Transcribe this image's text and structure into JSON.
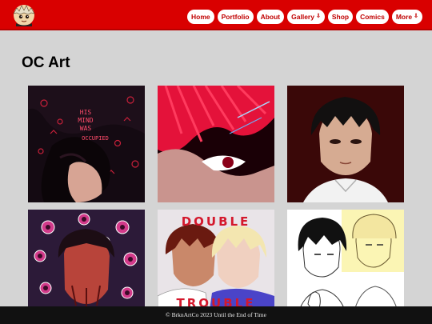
{
  "header": {
    "logo_icon": "chibi-character-logo-icon",
    "nav": [
      {
        "label": "Home",
        "dropdown": false
      },
      {
        "label": "Portfolio",
        "dropdown": false
      },
      {
        "label": "About",
        "dropdown": false
      },
      {
        "label": "Gallery",
        "dropdown": true
      },
      {
        "label": "Shop",
        "dropdown": false
      },
      {
        "label": "Comics",
        "dropdown": false
      },
      {
        "label": "More",
        "dropdown": true
      }
    ],
    "dropdown_glyph": "⇩"
  },
  "main": {
    "title": "OC Art",
    "artworks": [
      {
        "name": "artwork-his-mind-was-occupied",
        "caption_lines": [
          "HIS",
          "MIND",
          "WAS",
          "OCCUPIED"
        ]
      },
      {
        "name": "artwork-red-hair-closeup"
      },
      {
        "name": "artwork-dark-hair-portrait"
      },
      {
        "name": "artwork-eyes-surrounding-figure"
      },
      {
        "name": "artwork-double-trouble",
        "caption_top": "DOUBLE",
        "caption_bottom": "TROUBLE"
      },
      {
        "name": "artwork-sketch-duo"
      }
    ]
  },
  "footer": {
    "text": "© BrknArtCo 2023 Until the End of Time"
  },
  "colors": {
    "header_red": "#d90000",
    "nav_text": "#c00000",
    "page_bg": "#d4d4d4",
    "footer_bg": "#111111"
  }
}
